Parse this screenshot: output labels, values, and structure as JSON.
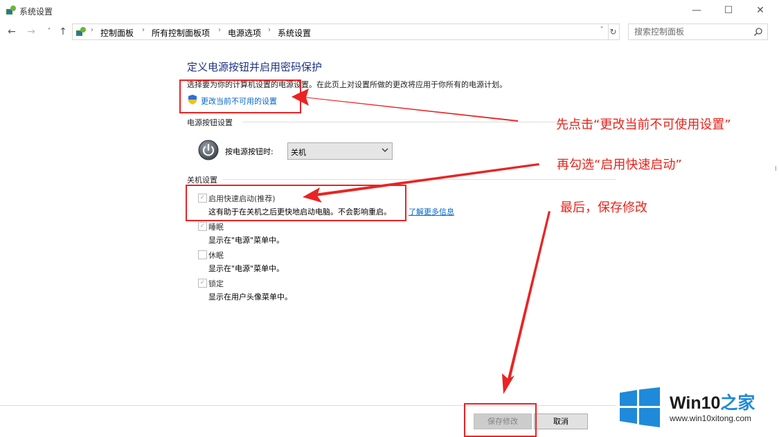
{
  "window": {
    "title": "系统设置",
    "minimize_glyph": "—",
    "maximize_glyph": "☐",
    "close_glyph": "✕"
  },
  "nav": {
    "back_glyph": "←",
    "forward_glyph": "→",
    "recent_glyph": "˅",
    "up_glyph": "↑",
    "breadcrumb_separator": "›",
    "breadcrumbs": [
      "控制面板",
      "所有控制面板项",
      "电源选项",
      "系统设置"
    ],
    "dropdown_glyph": "˅",
    "refresh_glyph": "↻",
    "search_placeholder": "搜索控制面板"
  },
  "main": {
    "heading": "定义电源按钮并启用密码保护",
    "description": "选择要为你的计算机设置的电源设置。在此页上对设置所做的更改将应用于你所有的电源计划。",
    "change_settings_link": "更改当前不可用的设置",
    "power_button_section": "电源按钮设置",
    "power_button_label": "按电源按钮时:",
    "power_button_value": "关机",
    "shutdown_section": "关机设置",
    "options": [
      {
        "title": "启用快速启动(推荐)",
        "subtitle": "这有助于在关机之后更快地启动电脑。不会影响重启。",
        "checked": true,
        "enabled": false
      },
      {
        "title": "睡眠",
        "subtitle": "显示在\"电源\"菜单中。",
        "checked": true,
        "enabled": false
      },
      {
        "title": "休眠",
        "subtitle": "显示在\"电源\"菜单中。",
        "checked": false,
        "enabled": false
      },
      {
        "title": "锁定",
        "subtitle": "显示在用户头像菜单中。",
        "checked": true,
        "enabled": false
      }
    ],
    "check_glyph": "✓",
    "learn_more_link": "了解更多信息"
  },
  "buttons": {
    "save": "保存修改",
    "cancel": "取消"
  },
  "annotations": {
    "step1": "先点击“更改当前不可使用设置”",
    "step2": "再勾选“启用快速启动”",
    "step3": "最后，保存修改",
    "color": "#ea2323"
  },
  "watermark": {
    "brand_main": "Win10",
    "brand_accent": "之家",
    "url": "www.win10xitong.com",
    "logo_color": "#1f8ad9"
  },
  "colors": {
    "heading": "#1e3287",
    "link": "#0066cc"
  }
}
